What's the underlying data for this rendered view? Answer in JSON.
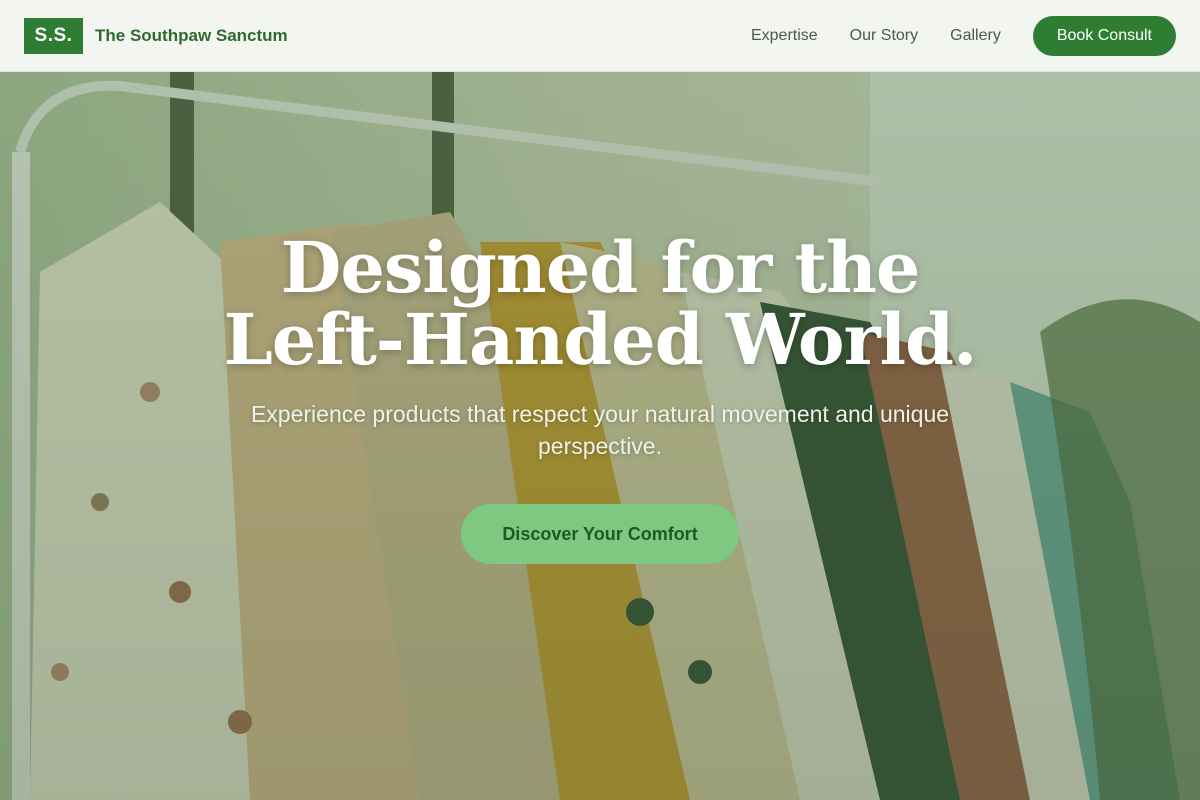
{
  "header": {
    "logo_text": "S.S.",
    "brand_name": "The Southpaw Sanctum",
    "nav": [
      {
        "label": "Expertise"
      },
      {
        "label": "Our Story"
      },
      {
        "label": "Gallery"
      }
    ],
    "cta_label": "Book Consult"
  },
  "hero": {
    "title": "Designed for the Left-Handed World.",
    "subtitle": "Experience products that respect your natural movement and unique perspective.",
    "cta_label": "Discover Your Comfort",
    "background_image": "clothing-rack-photo"
  },
  "colors": {
    "brand_green": "#2e7d32",
    "cta_light_green": "#7ec882",
    "cta_text": "#1f5a23"
  }
}
